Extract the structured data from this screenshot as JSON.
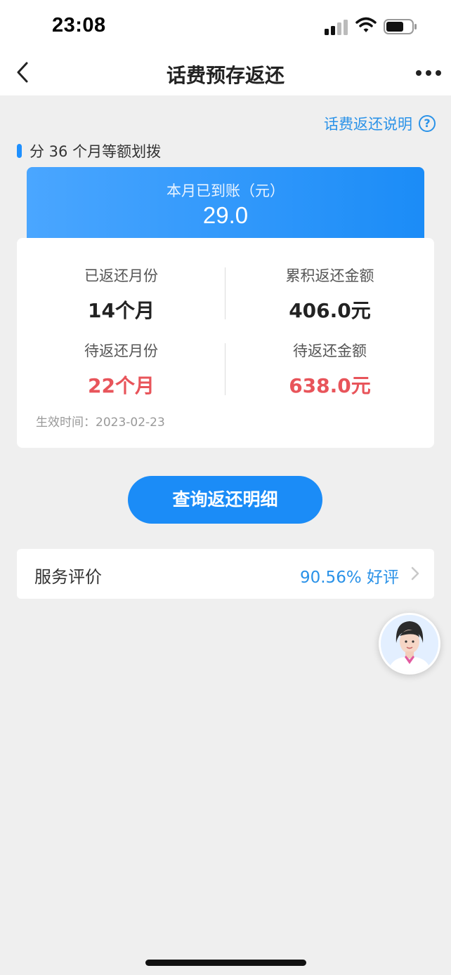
{
  "status_bar": {
    "time": "23:08"
  },
  "nav": {
    "title": "话费预存返还"
  },
  "help_link": {
    "label": "话费返还说明",
    "icon_text": "?"
  },
  "section": {
    "title": "分 36 个月等额划拨"
  },
  "banner": {
    "label": "本月已到账（元）",
    "value": "29.0"
  },
  "stats": {
    "returned_months_label": "已返还月份",
    "returned_months_value": "14个月",
    "returned_amount_label": "累积返还金额",
    "returned_amount_value": "406.0元",
    "pending_months_label": "待返还月份",
    "pending_months_value": "22个月",
    "pending_amount_label": "待返还金额",
    "pending_amount_value": "638.0元",
    "effective_time": "生效时间：2023-02-23"
  },
  "query_button": {
    "label": "查询返还明细"
  },
  "service": {
    "label": "服务评价",
    "rating": "90.56% 好评"
  },
  "icons": {
    "back": "back-arrow-icon",
    "more": "more-dots-icon",
    "help": "help-circle-icon",
    "chevron": "chevron-right-icon",
    "signal": "signal-icon",
    "wifi": "wifi-icon",
    "battery": "battery-icon"
  },
  "colors": {
    "accent_blue": "#1b8cf7",
    "link_blue": "#2a92e8",
    "warning_red": "#e8545a",
    "page_bg": "#efefef"
  }
}
